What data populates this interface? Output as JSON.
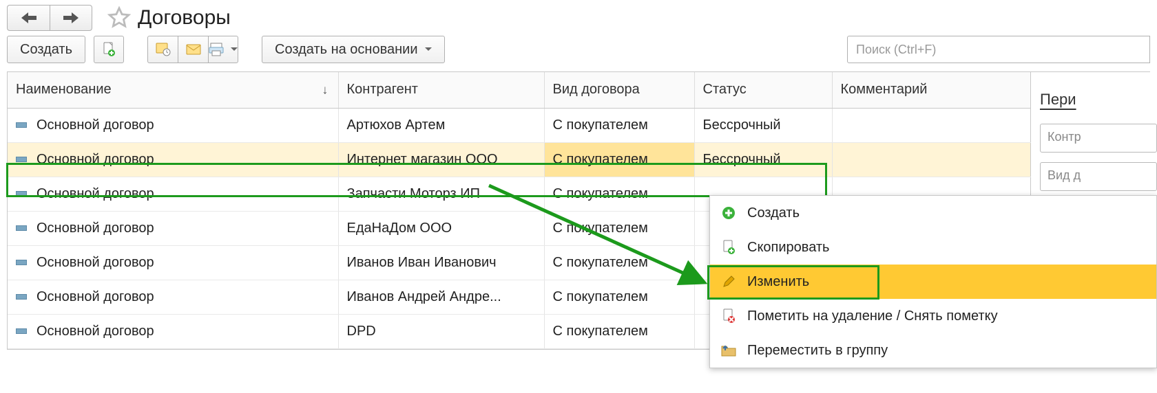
{
  "page": {
    "title": "Договоры"
  },
  "toolbar": {
    "create": "Создать",
    "create_based_on": "Создать на основании"
  },
  "search": {
    "placeholder": "Поиск (Ctrl+F)"
  },
  "table": {
    "headers": {
      "name": "Наименование",
      "counterparty": "Контрагент",
      "kind": "Вид договора",
      "status": "Статус",
      "comment": "Комментарий"
    },
    "sort_indicator": "↓",
    "rows": [
      {
        "name": "Основной договор",
        "counterparty": "Артюхов Артем",
        "kind": "С покупателем",
        "status": "Бессрочный",
        "selected": false
      },
      {
        "name": "Основной договор",
        "counterparty": "Интернет магазин ООО",
        "kind": "С покупателем",
        "status": "Бессрочный",
        "selected": true
      },
      {
        "name": "Основной договор",
        "counterparty": "Запчасти Моторз ИП",
        "kind": "С покупателем",
        "status": "",
        "selected": false
      },
      {
        "name": "Основной договор",
        "counterparty": "ЕдаНаДом ООО",
        "kind": "С покупателем",
        "status": "",
        "selected": false
      },
      {
        "name": "Основной договор",
        "counterparty": "Иванов Иван Иванович",
        "kind": "С покупателем",
        "status": "",
        "selected": false
      },
      {
        "name": "Основной договор",
        "counterparty": "Иванов Андрей Андре...",
        "kind": "С покупателем",
        "status": "",
        "selected": false
      },
      {
        "name": "Основной договор",
        "counterparty": "DPD",
        "kind": "С покупателем",
        "status": "",
        "selected": false
      }
    ]
  },
  "context_menu": {
    "items": [
      {
        "icon": "plus",
        "label": "Создать"
      },
      {
        "icon": "copy",
        "label": "Скопировать"
      },
      {
        "icon": "pencil",
        "label": "Изменить",
        "highlight": true
      },
      {
        "icon": "delete",
        "label": "Пометить на удаление / Снять пометку"
      },
      {
        "icon": "folder",
        "label": "Переместить в группу"
      }
    ]
  },
  "side": {
    "period": "Пери",
    "f1": "Контр",
    "f2": "Вид д"
  },
  "icons": {
    "plus_color": "#3bb23b",
    "pencil_color": "#e1a500",
    "delete_color": "#d33",
    "folder_color": "#e8c06a"
  }
}
